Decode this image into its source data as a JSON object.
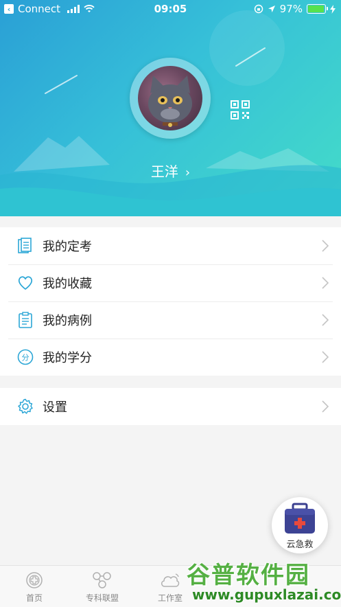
{
  "status_bar": {
    "back_app": "Connect",
    "time": "09:05",
    "battery": "97%"
  },
  "profile": {
    "name": "王洋"
  },
  "menu": [
    {
      "label": "我的定考"
    },
    {
      "label": "我的收藏"
    },
    {
      "label": "我的病例"
    },
    {
      "label": "我的学分"
    }
  ],
  "settings": {
    "label": "设置"
  },
  "fab": {
    "label": "云急救"
  },
  "tabs": [
    {
      "label": "首页"
    },
    {
      "label": "专科联盟"
    },
    {
      "label": "工作室"
    }
  ],
  "watermark": {
    "line1": "谷普软件园",
    "line2": "www.gupuxlazai.com"
  },
  "colors": {
    "accent": "#2ba6d6",
    "header_start": "#2a9fd6",
    "header_end": "#44dcc8"
  }
}
